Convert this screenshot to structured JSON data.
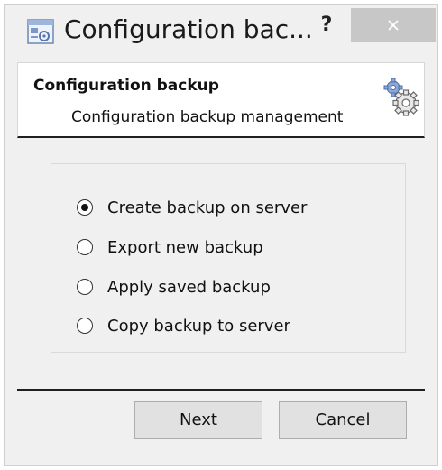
{
  "window": {
    "title": "Configuration bac...",
    "help_label": "?"
  },
  "header": {
    "title": "Configuration backup",
    "subtitle": "Configuration backup management"
  },
  "options": [
    {
      "label": "Create backup on server",
      "checked": true
    },
    {
      "label": "Export new backup",
      "checked": false
    },
    {
      "label": "Apply saved backup",
      "checked": false
    },
    {
      "label": "Copy backup to server",
      "checked": false
    }
  ],
  "buttons": {
    "next_label": "Next",
    "cancel_label": "Cancel"
  },
  "colors": {
    "window_bg": "#f0f0f0",
    "close_button_bg": "#c7c7c7",
    "header_bg": "#ffffff"
  }
}
